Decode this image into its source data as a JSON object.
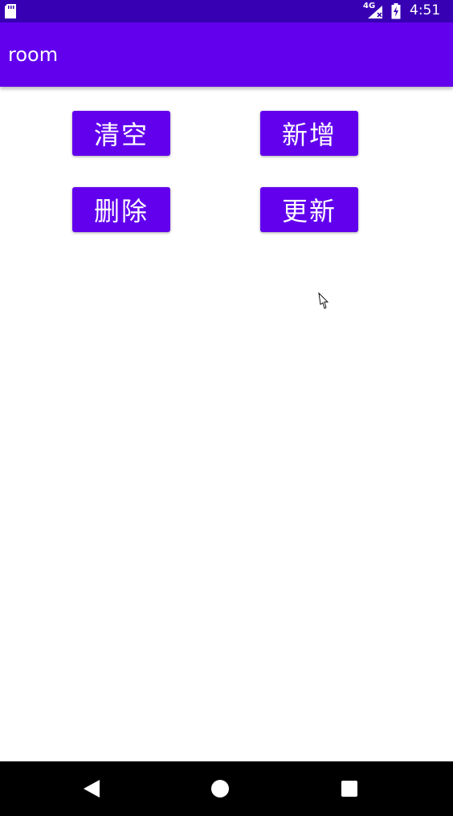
{
  "status_bar": {
    "network": "4G",
    "time": "4:51",
    "icons": [
      "sd-card-icon",
      "signal-icon",
      "battery-charging-icon"
    ]
  },
  "app_bar": {
    "title": "room"
  },
  "buttons": {
    "clear": "清空",
    "add": "新增",
    "delete": "删除",
    "update": "更新"
  },
  "nav_bar": {
    "icons": [
      "back-icon",
      "home-icon",
      "recents-icon"
    ]
  },
  "colors": {
    "status_bar": "#3700b3",
    "primary": "#6200ee",
    "background": "#ffffff",
    "nav_bar": "#000000"
  }
}
